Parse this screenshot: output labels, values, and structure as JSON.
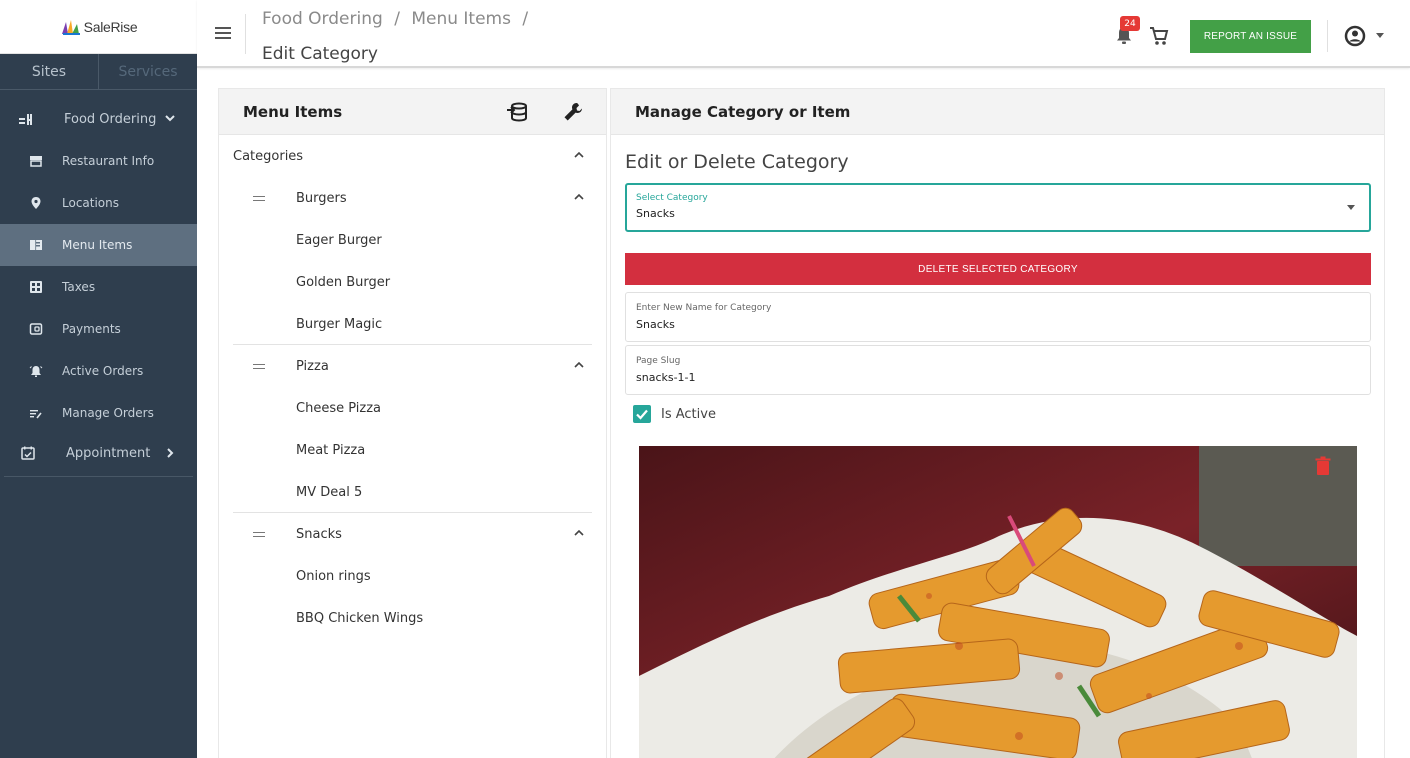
{
  "brand": {
    "name": "SaleRise"
  },
  "sidebar": {
    "tabs": [
      {
        "label": "Sites"
      },
      {
        "label": "Services"
      }
    ],
    "groups": [
      {
        "label": "Food Ordering",
        "icon": "food-icon"
      },
      {
        "label": "Appointment",
        "icon": "calendar-check-icon"
      }
    ],
    "items": [
      {
        "label": "Restaurant Info",
        "icon": "storefront-icon"
      },
      {
        "label": "Locations",
        "icon": "location-pin-icon"
      },
      {
        "label": "Menu Items",
        "icon": "menu-book-icon"
      },
      {
        "label": "Taxes",
        "icon": "calculator-icon"
      },
      {
        "label": "Payments",
        "icon": "wallet-icon"
      },
      {
        "label": "Active Orders",
        "icon": "alarm-bell-icon"
      },
      {
        "label": "Manage Orders",
        "icon": "list-edit-icon"
      }
    ]
  },
  "header": {
    "breadcrumb": [
      "Food Ordering",
      "/",
      "Menu Items",
      "/"
    ],
    "title": "Edit Category",
    "notification_count": "24",
    "report_label": "REPORT AN ISSUE",
    "accent_color": "#43a047"
  },
  "left_panel": {
    "title": "Menu Items",
    "root_label": "Categories",
    "categories": [
      {
        "name": "Burgers",
        "items": [
          "Eager Burger",
          "Golden Burger",
          "Burger Magic"
        ]
      },
      {
        "name": "Pizza",
        "items": [
          "Cheese Pizza",
          "Meat Pizza",
          "MV Deal 5"
        ]
      },
      {
        "name": "Snacks",
        "items": [
          "Onion rings",
          "BBQ Chicken Wings"
        ]
      }
    ]
  },
  "right_panel": {
    "title": "Manage Category or Item",
    "section_title": "Edit or Delete Category",
    "select": {
      "label": "Select Category",
      "value": "Snacks"
    },
    "delete_label": "DELETE SELECTED CATEGORY",
    "name_field": {
      "label": "Enter New Name for Category",
      "value": "Snacks"
    },
    "slug_field": {
      "label": "Page Slug",
      "value": "snacks-1-1"
    },
    "is_active": {
      "label": "Is Active",
      "checked": true
    },
    "danger_color": "#d32f3f",
    "focus_color": "#26a69a"
  }
}
